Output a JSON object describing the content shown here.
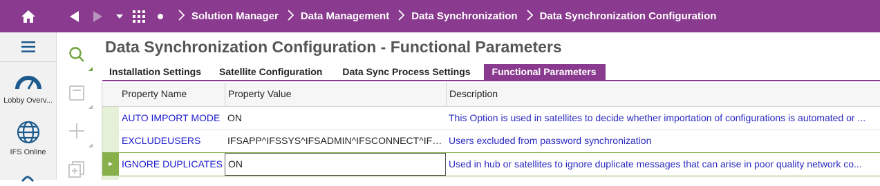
{
  "header": {
    "breadcrumbs": [
      "Solution Manager",
      "Data Management",
      "Data Synchronization",
      "Data Synchronization Configuration"
    ]
  },
  "sidebar": {
    "apps": [
      {
        "label": "Lobby Overv...",
        "icon": "gauge-icon"
      },
      {
        "label": "IFS Online",
        "icon": "globe-icon"
      }
    ]
  },
  "page": {
    "title": "Data Synchronization Configuration - Functional Parameters"
  },
  "tabs": [
    {
      "label": "Installation Settings",
      "active": false
    },
    {
      "label": "Satellite Configuration",
      "active": false
    },
    {
      "label": "Data Sync Process Settings",
      "active": false
    },
    {
      "label": "Functional Parameters",
      "active": true
    }
  ],
  "grid": {
    "columns": [
      "Property Name",
      "Property Value",
      "Description"
    ],
    "rows": [
      {
        "name": "AUTO IMPORT MODE",
        "value": "ON",
        "description": "This Option is used in satellites to decide whether importation of configurations is automated or ..."
      },
      {
        "name": "EXCLUDEUSERS",
        "value": "IFSAPP^IFSSYS^IFSADMIN^IFSCONNECT^IFSP...",
        "description": "Users excluded from password synchronization"
      },
      {
        "name": "IGNORE DUPLICATES",
        "value": "ON",
        "description": "Used in hub or satellites to ignore duplicate messages that can arise in poor quality network co..."
      }
    ],
    "active_row_marker": "►"
  },
  "colors": {
    "brand": "#8a3b8f",
    "selection": "#88b04b",
    "link": "#1a1acc"
  }
}
